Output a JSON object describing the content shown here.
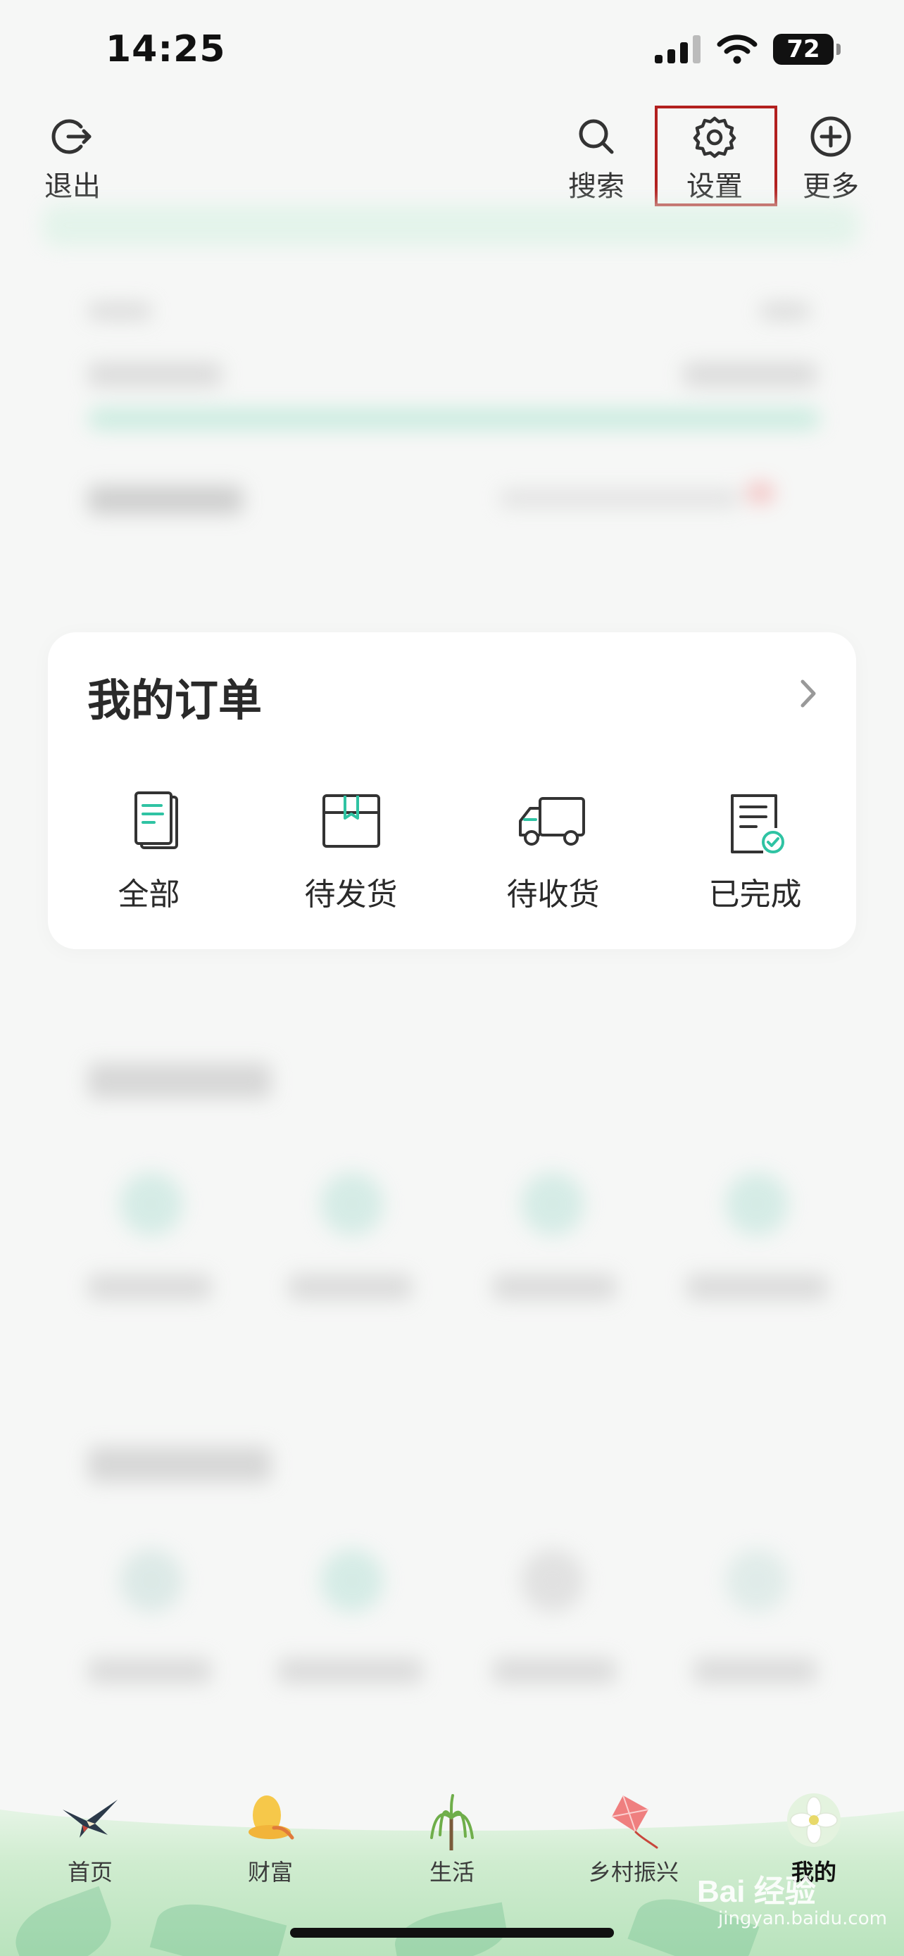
{
  "status_bar": {
    "time": "14:25",
    "battery": "72"
  },
  "top_bar": {
    "exit_label": "退出",
    "search_label": "搜索",
    "settings_label": "设置",
    "more_label": "更多"
  },
  "orders": {
    "title": "我的订单",
    "items": [
      {
        "label": "全部",
        "icon": "document-icon"
      },
      {
        "label": "待发货",
        "icon": "package-icon"
      },
      {
        "label": "待收货",
        "icon": "truck-icon"
      },
      {
        "label": "已完成",
        "icon": "checklist-icon"
      }
    ]
  },
  "tab_bar": {
    "tabs": [
      {
        "label": "首页",
        "icon": "swallow-icon"
      },
      {
        "label": "财富",
        "icon": "hat-icon"
      },
      {
        "label": "生活",
        "icon": "willow-tree-icon"
      },
      {
        "label": "乡村振兴",
        "icon": "kite-icon"
      },
      {
        "label": "我的",
        "icon": "flower-icon"
      }
    ],
    "active_index": 4
  },
  "watermark": {
    "text": "Bai 经验",
    "sub": "jingyan.baidu.com"
  },
  "colors": {
    "accent": "#2fc3a3",
    "highlight_border": "#b2201f",
    "card_bg": "#ffffff"
  }
}
